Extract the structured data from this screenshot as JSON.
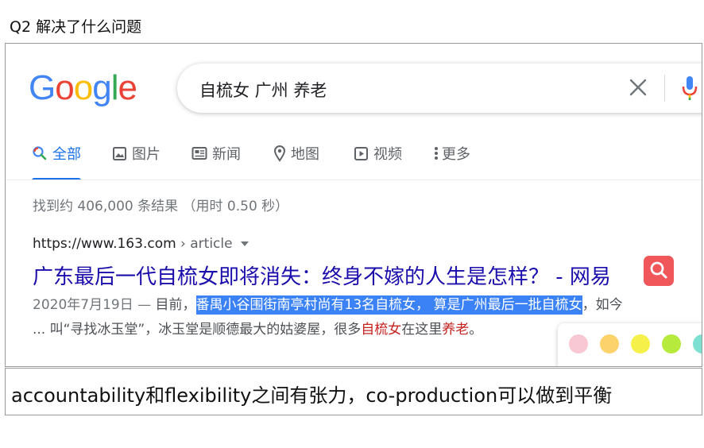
{
  "question": "Q2 解决了什么问题",
  "search": {
    "logo_letters": [
      {
        "ch": "G",
        "color": "#4285F4"
      },
      {
        "ch": "o",
        "color": "#EA4335"
      },
      {
        "ch": "o",
        "color": "#FBBC05"
      },
      {
        "ch": "g",
        "color": "#4285F4"
      },
      {
        "ch": "l",
        "color": "#34A853"
      },
      {
        "ch": "e",
        "color": "#EA4335"
      }
    ],
    "query": "自梳女 广州 养老",
    "tabs": [
      {
        "label": "全部",
        "icon": "search-icon",
        "active": true
      },
      {
        "label": "图片",
        "icon": "image-icon"
      },
      {
        "label": "新闻",
        "icon": "news-icon"
      },
      {
        "label": "地图",
        "icon": "map-pin-icon"
      },
      {
        "label": "视频",
        "icon": "video-icon"
      },
      {
        "label": "更多",
        "icon": "more-icon"
      }
    ],
    "stats": "找到约 406,000 条结果  （用时 0.50 秒）"
  },
  "result": {
    "url": "https://www.163.com",
    "path": " › article",
    "title": "广东最后一代自梳女即将消失：终身不嫁的人生是怎样？ - 网易",
    "date": "2020年7月19日 — ",
    "snippet_pre": "目前，",
    "snippet_highlight": "番禺小谷围街南亭村尚有13名自梳女， 算是广州最后一批自梳女",
    "snippet_post": "，如今",
    "line2_a": "... 叫“寻找冰玉堂”，冰玉堂是顺德最大的姑婆屋，很多",
    "line2_kw1": "自梳女",
    "line2_b": "在这里",
    "line2_kw2": "养老",
    "line2_c": "。"
  },
  "palette_colors": [
    "#f8c8d4",
    "#fcd36b",
    "#f5f04a",
    "#b6ea3c",
    "#7ee0d0"
  ],
  "answer": "accountability和flexibility之间有张力，co-production可以做到平衡"
}
